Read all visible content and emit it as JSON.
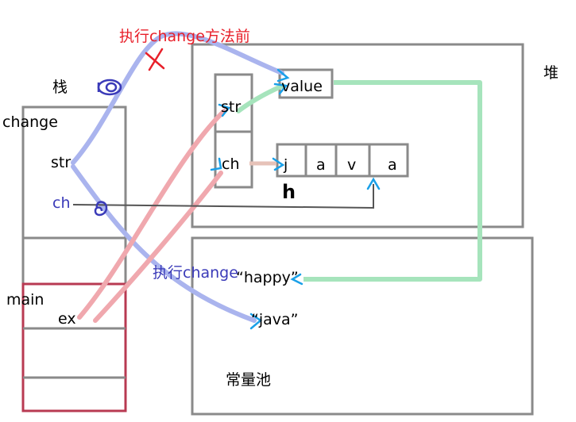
{
  "labels": {
    "before_change": "执行change方法前",
    "stack": "栈",
    "heap": "堆",
    "change_frame": "change",
    "str_var": "str",
    "ch_var": "ch",
    "main_frame": "main",
    "ex_var": "ex",
    "during_change": "执行change",
    "heap_str": "str",
    "heap_ch": "ch",
    "value": "value",
    "const_pool": "常量池",
    "happy": "“happy”",
    "java": "“java”",
    "handwritten_h": "h"
  },
  "char_array": [
    "j",
    "a",
    "v",
    "a"
  ],
  "colors": {
    "box_gray": "#8a8a8a",
    "main_red": "#b83a52",
    "red_text": "#e8202a",
    "blue_text": "#3a3ab8",
    "blue_arrow": "#aab4ee",
    "red_arrow": "#f0a8ae",
    "green_arrow": "#a6e4bc",
    "cyan_head": "#1aa0e8"
  }
}
